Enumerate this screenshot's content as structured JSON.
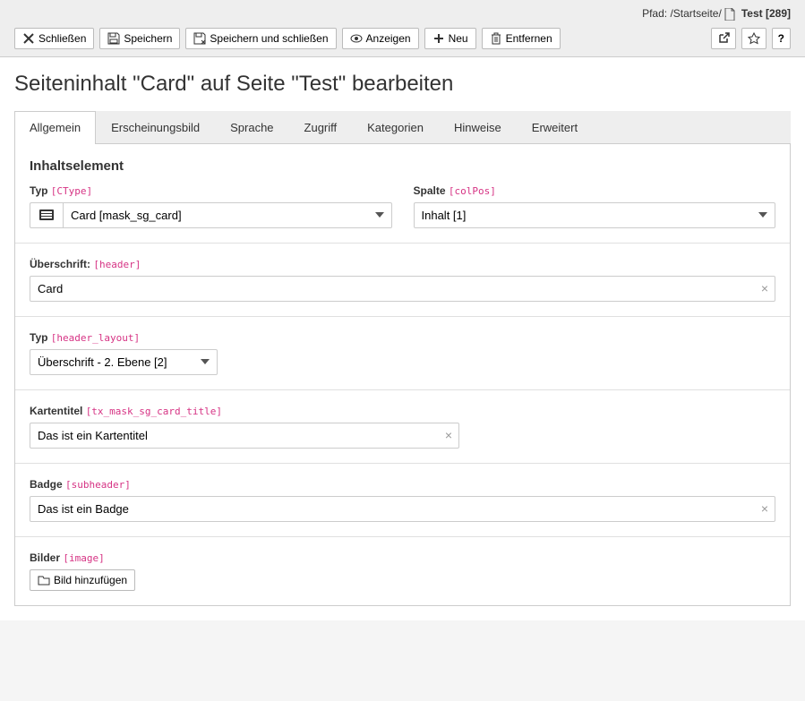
{
  "breadcrumb": {
    "prefix": "Pfad:",
    "root": "/Startseite/",
    "page": "Test",
    "id": "[289]"
  },
  "toolbar": {
    "close": "Schließen",
    "save": "Speichern",
    "save_close": "Speichern und schließen",
    "view": "Anzeigen",
    "new": "Neu",
    "delete": "Entfernen"
  },
  "title": "Seiteninhalt \"Card\" auf Seite \"Test\" bearbeiten",
  "tabs": [
    {
      "label": "Allgemein",
      "active": true
    },
    {
      "label": "Erscheinungsbild"
    },
    {
      "label": "Sprache"
    },
    {
      "label": "Zugriff"
    },
    {
      "label": "Kategorien"
    },
    {
      "label": "Hinweise"
    },
    {
      "label": "Erweitert"
    }
  ],
  "section": "Inhaltselement",
  "fields": {
    "ctype": {
      "label": "Typ",
      "tech": "[CType]",
      "value": "Card [mask_sg_card]"
    },
    "colpos": {
      "label": "Spalte",
      "tech": "[colPos]",
      "value": "Inhalt [1]"
    },
    "header": {
      "label": "Überschrift:",
      "tech": "[header]",
      "value": "Card"
    },
    "header_layout": {
      "label": "Typ",
      "tech": "[header_layout]",
      "value": "Überschrift - 2. Ebene [2]"
    },
    "card_title": {
      "label": "Kartentitel",
      "tech": "[tx_mask_sg_card_title]",
      "value": "Das ist ein Kartentitel"
    },
    "badge": {
      "label": "Badge",
      "tech": "[subheader]",
      "value": "Das ist ein Badge"
    },
    "image": {
      "label": "Bilder",
      "tech": "[image]",
      "button": "Bild hinzufügen"
    }
  }
}
